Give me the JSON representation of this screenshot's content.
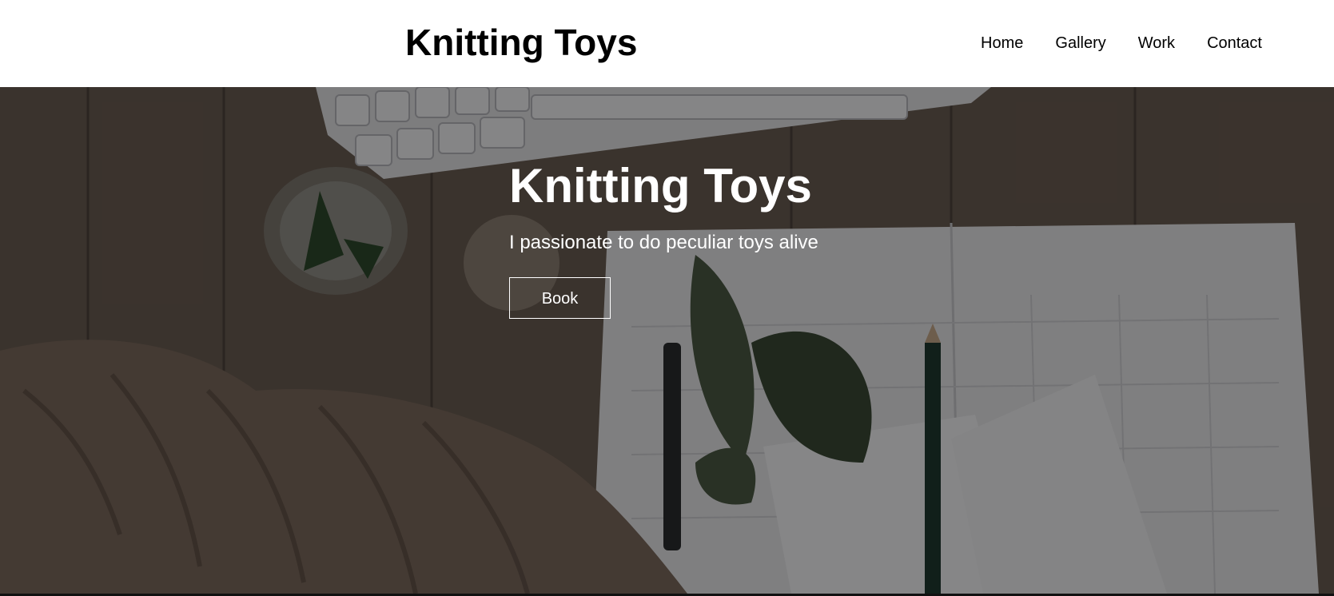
{
  "header": {
    "brand": "Knitting Toys",
    "nav": [
      {
        "label": "Home"
      },
      {
        "label": "Gallery"
      },
      {
        "label": "Work"
      },
      {
        "label": "Contact"
      }
    ]
  },
  "hero": {
    "title": "Knitting Toys",
    "subtitle": "I passionate to do peculiar toys alive",
    "button_label": "Book",
    "background_description_icon": "knitting-desk-photo"
  },
  "colors": {
    "header_bg": "#ffffff",
    "text_dark": "#000000",
    "hero_text": "#ffffff"
  }
}
